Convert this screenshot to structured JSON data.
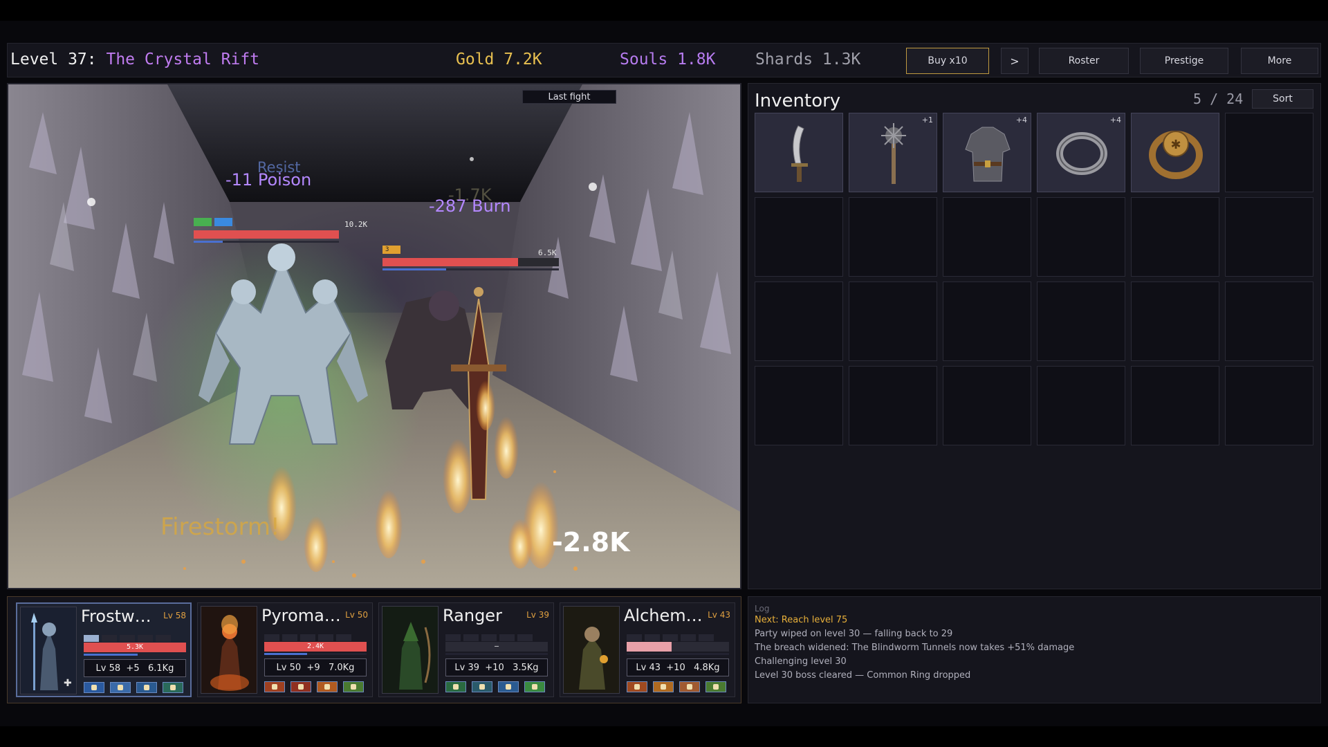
{
  "header": {
    "level_label": "Level 37:",
    "zone_name": "The Crystal Rift",
    "gold": "Gold 7.2K",
    "souls": "Souls 1.8K",
    "shards": "Shards 1.3K",
    "buy_label": "Buy x10",
    "next_label": ">",
    "roster_label": "Roster",
    "prestige_label": "Prestige",
    "more_label": "More"
  },
  "colors": {
    "gold": "#e8c050",
    "souls": "#b77cf0",
    "shards": "#a0a0aa",
    "hp_red": "#e05050",
    "mana_blue": "#4a70d0"
  },
  "battle": {
    "last_fight_label": "Last fight",
    "combat_texts": {
      "resist": "Resist",
      "poison": "-11 Poison",
      "burn_faded": "-1.7K",
      "burn": "-287 Burn",
      "firestorm": "Firestorm!",
      "damage": "-2.8K"
    },
    "enemies": [
      {
        "name": "crystal-hydra",
        "hp_text": "10.2K",
        "hp_fraction": 1.0,
        "mana_fraction": 0.2,
        "status_icons": [
          "poison",
          "frost"
        ]
      },
      {
        "name": "rock-golem",
        "hp_text": "6.5K",
        "hp_fraction": 0.77,
        "mana_fraction": 0.36,
        "status_icons": [
          "burn"
        ],
        "status_count": "3"
      }
    ]
  },
  "inventory": {
    "title": "Inventory",
    "count": "5 / 24",
    "sort_label": "Sort",
    "items": [
      {
        "icon": "curved-dagger-icon",
        "plus": ""
      },
      {
        "icon": "spiked-mace-icon",
        "plus": "+1"
      },
      {
        "icon": "chainmail-armor-icon",
        "plus": "+4"
      },
      {
        "icon": "iron-ring-icon",
        "plus": "+4"
      },
      {
        "icon": "gold-signet-ring-icon",
        "plus": ""
      }
    ]
  },
  "party": [
    {
      "name": "Frostw…",
      "level": "Lv 58",
      "hp_text": "5.3K",
      "hp_fraction": 1.0,
      "mana_fraction": 0.53,
      "stats": "Lv 58  +5   6.1Kg",
      "selected": true,
      "hp_color": "#e05050"
    },
    {
      "name": "Pyroma…",
      "level": "Lv 50",
      "hp_text": "2.4K",
      "hp_fraction": 1.0,
      "mana_fraction": 0.42,
      "stats": "Lv 50  +9   7.0Kg",
      "selected": false,
      "hp_color": "#e05050"
    },
    {
      "name": "Ranger",
      "level": "Lv 39",
      "hp_text": "—",
      "hp_fraction": 0.0,
      "mana_fraction": 0.0,
      "stats": "Lv 39  +10   3.5Kg",
      "selected": false,
      "hp_color": "#e05050"
    },
    {
      "name": "Alchem…",
      "level": "Lv 43",
      "hp_text": "",
      "hp_fraction": 0.44,
      "mana_fraction": 0.0,
      "stats": "Lv 43  +10   4.8Kg",
      "selected": false,
      "hp_color": "#e8a0a8"
    }
  ],
  "log": {
    "title": "Log",
    "lines": [
      {
        "text": "Next: Reach level 75",
        "highlight": true
      },
      {
        "text": "Party wiped on level 30 — falling back to 29",
        "highlight": false
      },
      {
        "text": "The breach widened: The Blindworm Tunnels now takes +51% damage",
        "highlight": false
      },
      {
        "text": "Challenging level 30",
        "highlight": false
      },
      {
        "text": "Level 30 boss cleared — Common Ring dropped",
        "highlight": false
      }
    ]
  }
}
